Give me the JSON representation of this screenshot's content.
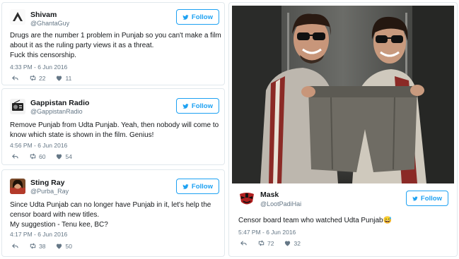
{
  "tweets": [
    {
      "name": "Shivam",
      "handle": "@GhantaGuy",
      "follow_label": "Follow",
      "lines": [
        "Drugs are the number 1 problem in Punjab so you can't make a film",
        "about it as the ruling party views it as a threat.",
        "Fuck this censorship."
      ],
      "time": "4:33 PM - 6 Jun 2016",
      "retweets": "22",
      "likes": "11"
    },
    {
      "name": "Gappistan Radio",
      "handle": "@GappistanRadio",
      "follow_label": "Follow",
      "lines": [
        "Remove Punjab from Udta Punjab. Yeah, then nobody will come to",
        "know which state is shown in the film. Genius!"
      ],
      "time": "4:56 PM - 6 Jun 2016",
      "retweets": "60",
      "likes": "54"
    },
    {
      "name": "Sting Ray",
      "handle": "@Purba_Ray",
      "follow_label": "Follow",
      "lines": [
        "Since Udta Punjab can no longer have Punjab in it, let's help the",
        "censor board with new titles.",
        "My suggestion - Tenu kee, BC?"
      ],
      "time": "4:17 PM - 6 Jun 2016",
      "retweets": "38",
      "likes": "50"
    },
    {
      "name": "Mask",
      "handle": "@LootPadiHai",
      "follow_label": "Follow",
      "lines": [
        "Censor board team who watched Udta Punjab"
      ],
      "emoji": "😅",
      "time": "5:47 PM - 6 Jun 2016",
      "retweets": "72",
      "likes": "32"
    }
  ],
  "icons": {
    "follow": "twitter-bird-icon",
    "reply": "reply-icon",
    "retweet": "retweet-icon",
    "like": "heart-icon"
  },
  "colors": {
    "twitter_blue": "#1da1f2",
    "muted": "#657786",
    "border": "#e1e8ed"
  }
}
